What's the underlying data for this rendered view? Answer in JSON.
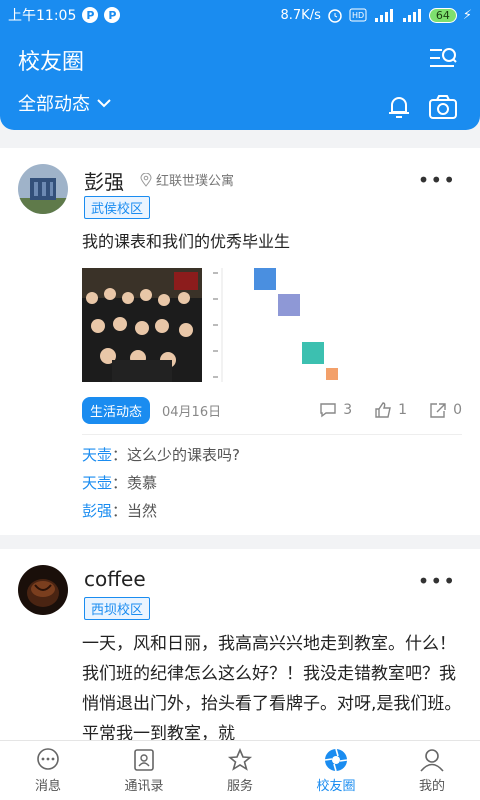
{
  "status": {
    "time": "上午11:05",
    "speed": "8.7K/s",
    "battery": "64"
  },
  "header": {
    "title": "校友圈",
    "filter": "全部动态"
  },
  "posts": [
    {
      "author": "彭强",
      "location": "红联世璞公寓",
      "campus": "武侯校区",
      "text": "我的课表和我们的优秀毕业生",
      "tag": "生活动态",
      "date": "04月16日",
      "comments_count": "3",
      "likes": "1",
      "shares": "0",
      "comments": [
        {
          "who": "天壶",
          "text": "这么少的课表吗?"
        },
        {
          "who": "天壶",
          "text": "羡慕"
        },
        {
          "who": "彭强",
          "text": "当然"
        }
      ]
    },
    {
      "author": "coffee",
      "campus": "西坝校区",
      "text": "一天，风和日丽，我高高兴兴地走到教室。什么！我们班的纪律怎么这么好？！我没走错教室吧？我悄悄退出门外，抬头看了看牌子。对呀,是我们班。平常我一到教室，就"
    }
  ],
  "tabs": [
    {
      "label": "消息",
      "icon": "message-icon"
    },
    {
      "label": "通讯录",
      "icon": "contacts-icon"
    },
    {
      "label": "服务",
      "icon": "star-icon"
    },
    {
      "label": "校友圈",
      "icon": "shutter-icon"
    },
    {
      "label": "我的",
      "icon": "person-icon"
    }
  ],
  "colors": {
    "accent": "#1a8cf0"
  }
}
